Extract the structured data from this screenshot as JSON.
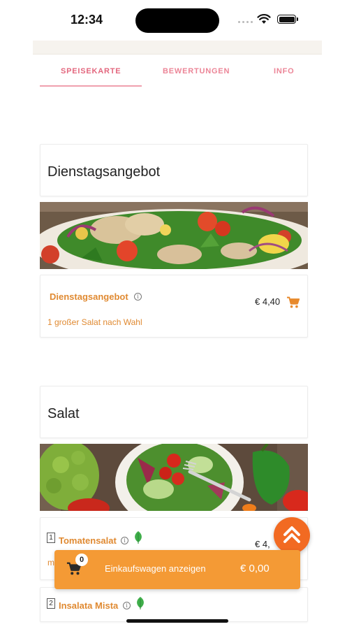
{
  "status_bar": {
    "time": "12:34"
  },
  "tabs": [
    {
      "label": "SPEISEKARTE",
      "active": true
    },
    {
      "label": "BEWERTUNGEN",
      "active": false
    },
    {
      "label": "INFO",
      "active": false
    }
  ],
  "sections": [
    {
      "title": "Dienstagsangebot",
      "image": "salad-chicken-photo",
      "items": [
        {
          "name": "Dienstagsangebot",
          "price": "€ 4,40",
          "description": "1 großer Salat nach Wahl"
        }
      ]
    },
    {
      "title": "Salat",
      "image": "salad-bowl-vegetables-photo",
      "items": [
        {
          "number": "1",
          "name": "Tomatensalat",
          "price": "€ 4,",
          "description": "m",
          "vegetarian": true
        },
        {
          "number": "2",
          "name": "Insalata Mista",
          "vegetarian": true
        }
      ]
    }
  ],
  "cart": {
    "count": "0",
    "label": "Einkaufswagen anzeigen",
    "total": "€ 0,00"
  },
  "colors": {
    "accent_pink": "#e3677e",
    "item_orange": "#e08a32",
    "cart_bar": "#f49a35",
    "fab": "#f26a22"
  },
  "icons": [
    "wifi-icon",
    "battery-icon",
    "info-icon",
    "cart-icon",
    "leaf-icon",
    "double-chevron-up-icon"
  ]
}
